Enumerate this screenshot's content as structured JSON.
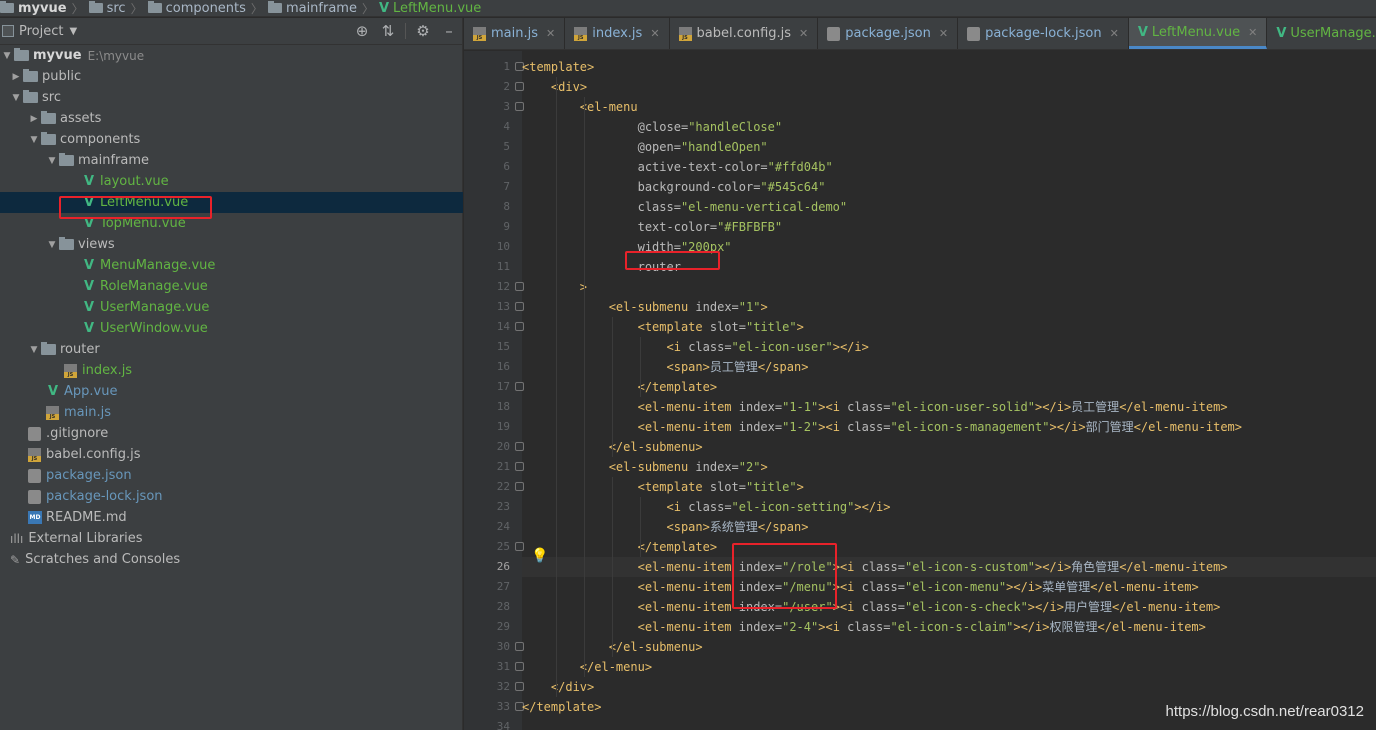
{
  "breadcrumb": {
    "items": [
      "myvue",
      "src",
      "components",
      "mainframe",
      "LeftMenu.vue"
    ]
  },
  "project_panel": {
    "title": "Project",
    "tree": [
      {
        "label": "myvue",
        "note": "E:\\myvue"
      },
      {
        "label": "public"
      },
      {
        "label": "src"
      },
      {
        "label": "assets"
      },
      {
        "label": "components"
      },
      {
        "label": "mainframe"
      },
      {
        "label": "layout.vue"
      },
      {
        "label": "LeftMenu.vue"
      },
      {
        "label": "TopMenu.vue"
      },
      {
        "label": "views"
      },
      {
        "label": "MenuManage.vue"
      },
      {
        "label": "RoleManage.vue"
      },
      {
        "label": "UserManage.vue"
      },
      {
        "label": "UserWindow.vue"
      },
      {
        "label": "router"
      },
      {
        "label": "index.js"
      },
      {
        "label": "App.vue"
      },
      {
        "label": "main.js"
      },
      {
        "label": ".gitignore"
      },
      {
        "label": "babel.config.js"
      },
      {
        "label": "package.json"
      },
      {
        "label": "package-lock.json"
      },
      {
        "label": "README.md"
      },
      {
        "label": "External Libraries"
      },
      {
        "label": "Scratches and Consoles"
      }
    ]
  },
  "tabs": [
    "main.js",
    "index.js",
    "babel.config.js",
    "package.json",
    "package-lock.json",
    "LeftMenu.vue",
    "UserManage.vue",
    "U"
  ],
  "code_lines": [
    "<template>",
    "    <div>",
    "        <el-menu",
    "                @close=\"handleClose\"",
    "                @open=\"handleOpen\"",
    "                active-text-color=\"#ffd04b\"",
    "                background-color=\"#545c64\"",
    "                class=\"el-menu-vertical-demo\"",
    "                text-color=\"#FBFBFB\"",
    "                width=\"200px\"",
    "                router",
    "        >",
    "            <el-submenu index=\"1\">",
    "                <template slot=\"title\">",
    "                    <i class=\"el-icon-user\"></i>",
    "                    <span>员工管理</span>",
    "                </template>",
    "                <el-menu-item index=\"1-1\"><i class=\"el-icon-user-solid\"></i>员工管理</el-menu-item>",
    "                <el-menu-item index=\"1-2\"><i class=\"el-icon-s-management\"></i>部门管理</el-menu-item>",
    "            </el-submenu>",
    "            <el-submenu index=\"2\">",
    "                <template slot=\"title\">",
    "                    <i class=\"el-icon-setting\"></i>",
    "                    <span>系统管理</span>",
    "                </template>",
    "                <el-menu-item index=\"/role\"><i class=\"el-icon-s-custom\"></i>角色管理</el-menu-item>",
    "                <el-menu-item index=\"/menu\"><i class=\"el-icon-menu\"></i>菜单管理</el-menu-item>",
    "                <el-menu-item index=\"/user\"><i class=\"el-icon-s-check\"></i>用户管理</el-menu-item>",
    "                <el-menu-item index=\"2-4\"><i class=\"el-icon-s-claim\"></i>权限管理</el-menu-item>",
    "            </el-submenu>",
    "        </el-menu>",
    "    </div>",
    "</template>",
    ""
  ],
  "line_numbers": [
    "1",
    "2",
    "3",
    "4",
    "5",
    "6",
    "7",
    "8",
    "9",
    "10",
    "11",
    "12",
    "13",
    "14",
    "15",
    "16",
    "17",
    "18",
    "19",
    "20",
    "21",
    "22",
    "23",
    "24",
    "25",
    "26",
    "27",
    "28",
    "29",
    "30",
    "31",
    "32",
    "33",
    "34"
  ],
  "current_line": 26,
  "watermark": "https://blog.csdn.net/rear0312",
  "colors": {
    "tag": "#e8bf6a",
    "attr_value": "#a5c261",
    "vue_green": "#41b883",
    "highlight_box": "#e8222a",
    "selection": "#0d293e"
  }
}
